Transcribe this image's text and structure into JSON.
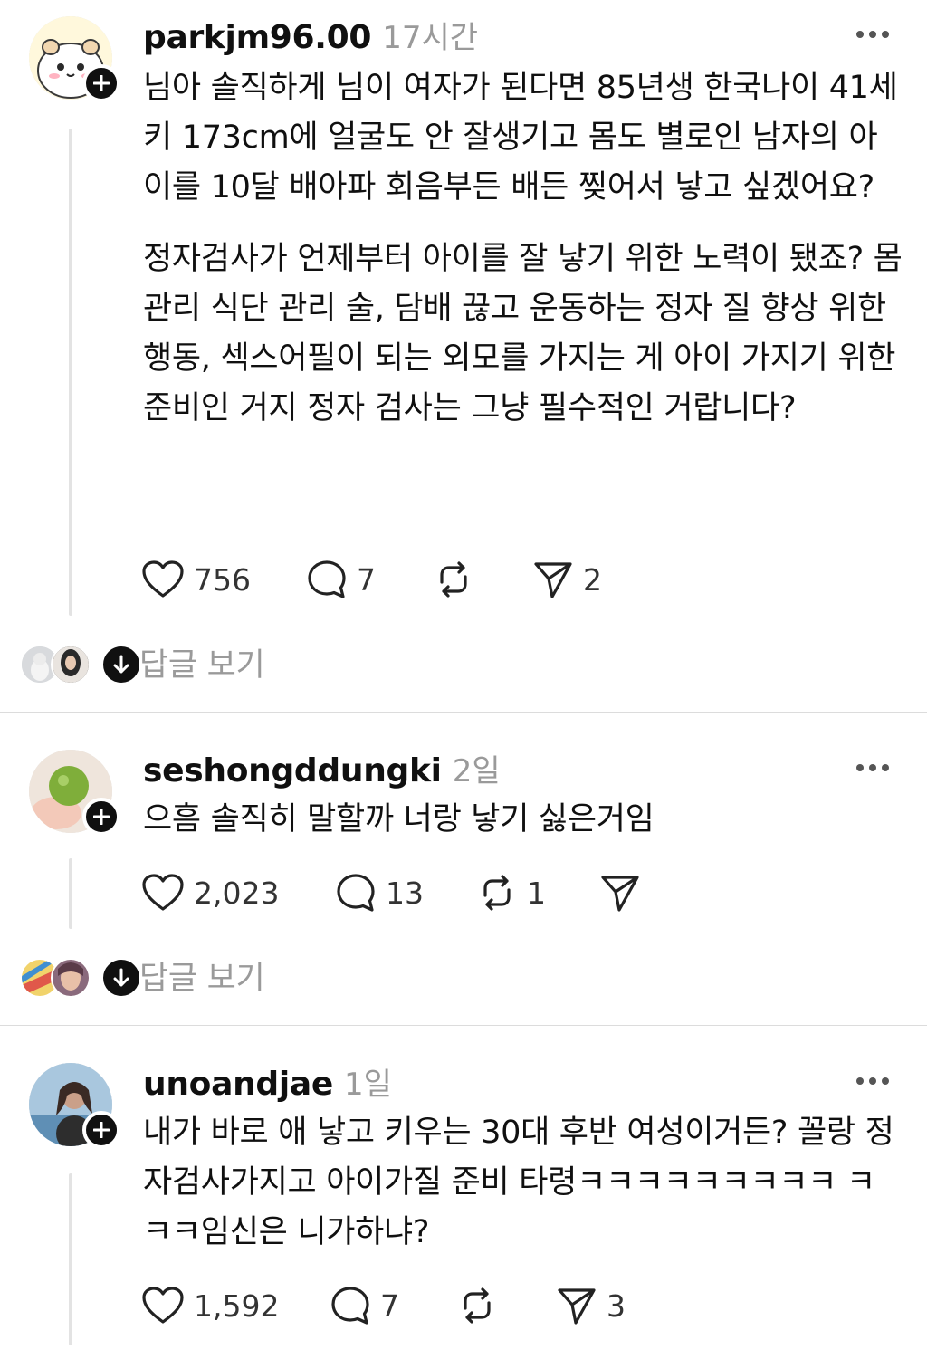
{
  "posts": [
    {
      "username": "parkjm96.00",
      "time": "17시간",
      "paragraphs": [
        "님아 솔직하게 님이 여자가 된다면 85년생 한국나이 41세 키 173cm에 얼굴도 안 잘생기고 몸도 별로인 남자의 아이를 10달 배아파 회음부든 배든 찢어서 낳고 싶겠어요?",
        "정자검사가 언제부터 아이를 잘 낳기 위한 노력이 됐죠? 몸 관리 식단 관리 술, 담배 끊고 운동하는 정자 질 향상 위한 행동, 섹스어필이 되는 외모를 가지는 게 아이 가지기 위한 준비인 거지 정자 검사는 그냥 필수적인 거랍니다?"
      ],
      "likes": "756",
      "comments": "7",
      "reposts": "",
      "shares": "2",
      "view_replies": "답글 보기"
    },
    {
      "username": "seshongddungki",
      "time": "2일",
      "paragraphs": [
        "으흠 솔직히 말할까 너랑 낳기 싫은거임"
      ],
      "likes": "2,023",
      "comments": "13",
      "reposts": "1",
      "shares": "",
      "view_replies": "답글 보기"
    },
    {
      "username": "unoandjae",
      "time": "1일",
      "paragraphs": [
        "내가 바로 애 낳고 키우는 30대 후반 여성이거든? 꼴랑 정자검사가지고 아이가질 준비 타령ㅋㅋㅋㅋㅋㅋㅋㅋㅋ ㅋㅋㅋ임신은 니가하냐?"
      ],
      "likes": "1,592",
      "comments": "7",
      "reposts": "",
      "shares": "3"
    }
  ],
  "icons": {
    "like": "heart-icon",
    "comment": "speech-bubble-icon",
    "repost": "repost-arrows-icon",
    "share": "paper-plane-icon",
    "more": "more-dots-icon",
    "follow": "plus-icon",
    "expand": "arrow-down-icon"
  },
  "colors": {
    "text": "#101010",
    "muted": "#9a9a9a",
    "divider": "#dcdcdc",
    "thread_line": "#e3e3e3"
  }
}
